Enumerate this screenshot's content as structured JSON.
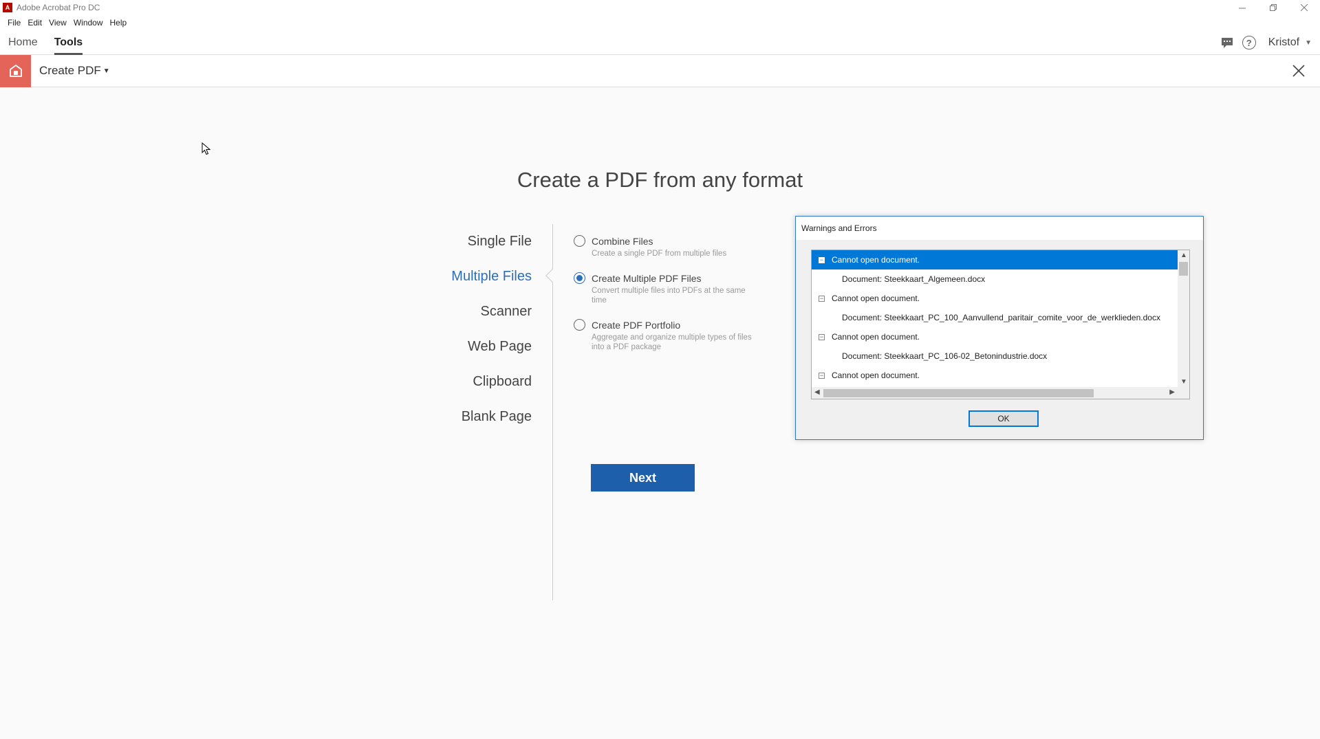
{
  "window": {
    "title": "Adobe Acrobat Pro DC",
    "app_icon_glyph": "A"
  },
  "menu": [
    "File",
    "Edit",
    "View",
    "Window",
    "Help"
  ],
  "topnav": {
    "tabs": [
      "Home",
      "Tools"
    ],
    "active_tab": "Tools",
    "user_name": "Kristof"
  },
  "tool": {
    "title": "Create PDF"
  },
  "main": {
    "heading": "Create a PDF from any format",
    "source_options": [
      "Single File",
      "Multiple Files",
      "Scanner",
      "Web Page",
      "Clipboard",
      "Blank Page"
    ],
    "selected_source": "Multiple Files",
    "radios": [
      {
        "label": "Combine Files",
        "desc": "Create a single PDF from multiple files",
        "checked": false
      },
      {
        "label": "Create Multiple PDF Files",
        "desc": "Convert multiple files into PDFs at the same time",
        "checked": true
      },
      {
        "label": "Create PDF Portfolio",
        "desc": "Aggregate and organize multiple types of files into a PDF package",
        "checked": false
      }
    ],
    "next_label": "Next"
  },
  "dialog": {
    "title": "Warnings and Errors",
    "rows": [
      {
        "type": "parent",
        "text": "Cannot open document.",
        "toggle": "−",
        "selected": true
      },
      {
        "type": "child",
        "text": "Document: Steekkaart_Algemeen.docx"
      },
      {
        "type": "parent",
        "text": "Cannot open document.",
        "toggle": "−"
      },
      {
        "type": "child",
        "text": "Document: Steekkaart_PC_100_Aanvullend_paritair_comite_voor_de_werklieden.docx"
      },
      {
        "type": "parent",
        "text": "Cannot open document.",
        "toggle": "−"
      },
      {
        "type": "child",
        "text": "Document: Steekkaart_PC_106-02_Betonindustrie.docx"
      },
      {
        "type": "parent",
        "text": "Cannot open document.",
        "toggle": "−"
      }
    ],
    "ok_label": "OK"
  },
  "colors": {
    "accent_blue": "#1e5fab",
    "tool_red": "#e5645a",
    "selection_blue": "#0078d7"
  }
}
